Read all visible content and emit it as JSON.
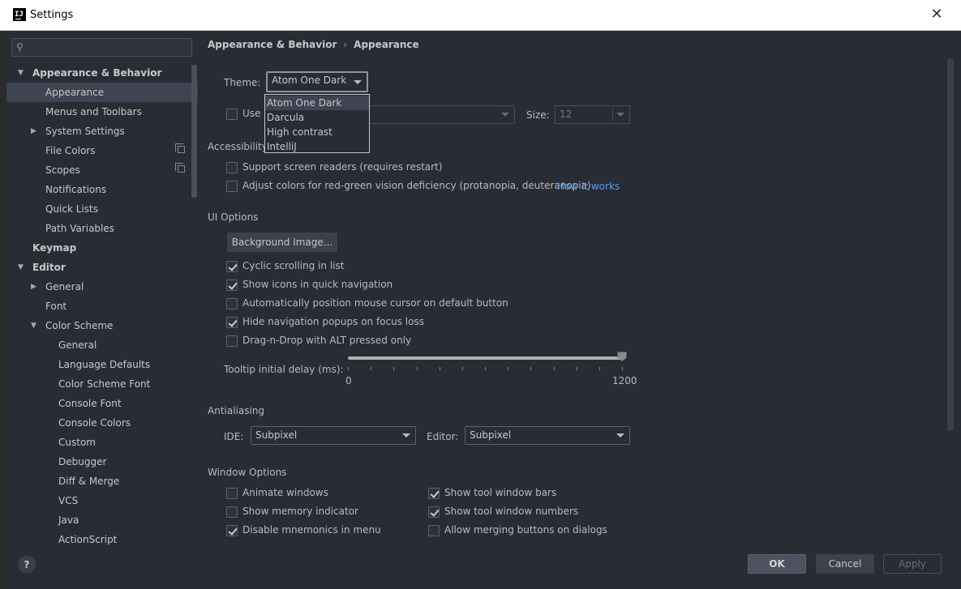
{
  "window": {
    "title": "Settings",
    "app_icon_text": "IJ"
  },
  "left": {
    "search_placeholder": "",
    "tree": [
      {
        "label": "Appearance & Behavior",
        "level": 0,
        "arrow": "down",
        "bold": true
      },
      {
        "label": "Appearance",
        "level": 1,
        "selected": true
      },
      {
        "label": "Menus and Toolbars",
        "level": 1
      },
      {
        "label": "System Settings",
        "level": 1,
        "arrow": "right"
      },
      {
        "label": "File Colors",
        "level": 1,
        "copy_icon": true
      },
      {
        "label": "Scopes",
        "level": 1,
        "copy_icon": true
      },
      {
        "label": "Notifications",
        "level": 1
      },
      {
        "label": "Quick Lists",
        "level": 1
      },
      {
        "label": "Path Variables",
        "level": 1
      },
      {
        "label": "Keymap",
        "level": 0,
        "bold": true
      },
      {
        "label": "Editor",
        "level": 0,
        "arrow": "down",
        "bold": true
      },
      {
        "label": "General",
        "level": 1,
        "arrow": "right"
      },
      {
        "label": "Font",
        "level": 1
      },
      {
        "label": "Color Scheme",
        "level": 1,
        "arrow": "down"
      },
      {
        "label": "General",
        "level": 2
      },
      {
        "label": "Language Defaults",
        "level": 2
      },
      {
        "label": "Color Scheme Font",
        "level": 2
      },
      {
        "label": "Console Font",
        "level": 2
      },
      {
        "label": "Console Colors",
        "level": 2
      },
      {
        "label": "Custom",
        "level": 2
      },
      {
        "label": "Debugger",
        "level": 2
      },
      {
        "label": "Diff & Merge",
        "level": 2
      },
      {
        "label": "VCS",
        "level": 2
      },
      {
        "label": "Java",
        "level": 2
      },
      {
        "label": "ActionScript",
        "level": 2
      }
    ],
    "help_label": "?"
  },
  "breadcrumb": {
    "first": "Appearance & Behavior",
    "sep": "›",
    "second": "Appearance"
  },
  "theme": {
    "label": "Theme:",
    "value": "Atom One Dark",
    "options": [
      "Atom One Dark",
      "Darcula",
      "High contrast",
      "IntelliJ"
    ]
  },
  "font_row": {
    "use_label": "Use c",
    "size_label": "Size:",
    "size_value": "12"
  },
  "accessibility": {
    "title": "Accessibility",
    "screen_readers": "Support screen readers (requires restart)",
    "color_adjust": "Adjust colors for red-green vision deficiency (protanopia, deuteranopia)",
    "how_it_works": "How it works"
  },
  "ui_options": {
    "title": "UI Options",
    "background_button": "Background Image...",
    "checkboxes": [
      {
        "label": "Cyclic scrolling in list",
        "checked": true
      },
      {
        "label": "Show icons in quick navigation",
        "checked": true
      },
      {
        "label": "Automatically position mouse cursor on default button",
        "checked": false
      },
      {
        "label": "Hide navigation popups on focus loss",
        "checked": true
      },
      {
        "label": "Drag-n-Drop with ALT pressed only",
        "checked": false
      }
    ],
    "tooltip_label": "Tooltip initial delay (ms):",
    "tooltip_min": "0",
    "tooltip_max": "1200",
    "tooltip_value_fraction": 1.0
  },
  "antialiasing": {
    "title": "Antialiasing",
    "ide_label": "IDE:",
    "ide_value": "Subpixel",
    "editor_label": "Editor:",
    "editor_value": "Subpixel"
  },
  "window_options": {
    "title": "Window Options",
    "left_col": [
      {
        "label": "Animate windows",
        "checked": false
      },
      {
        "label": "Show memory indicator",
        "checked": false
      },
      {
        "label": "Disable mnemonics in menu",
        "checked": true
      }
    ],
    "right_col": [
      {
        "label": "Show tool window bars",
        "checked": true
      },
      {
        "label": "Show tool window numbers",
        "checked": true
      },
      {
        "label": "Allow merging buttons on dialogs",
        "checked": false
      }
    ]
  },
  "buttons": {
    "ok": "OK",
    "cancel": "Cancel",
    "apply": "Apply"
  },
  "colors": {
    "background": "#282c34",
    "selection": "#3e4451",
    "link": "#589df6"
  }
}
